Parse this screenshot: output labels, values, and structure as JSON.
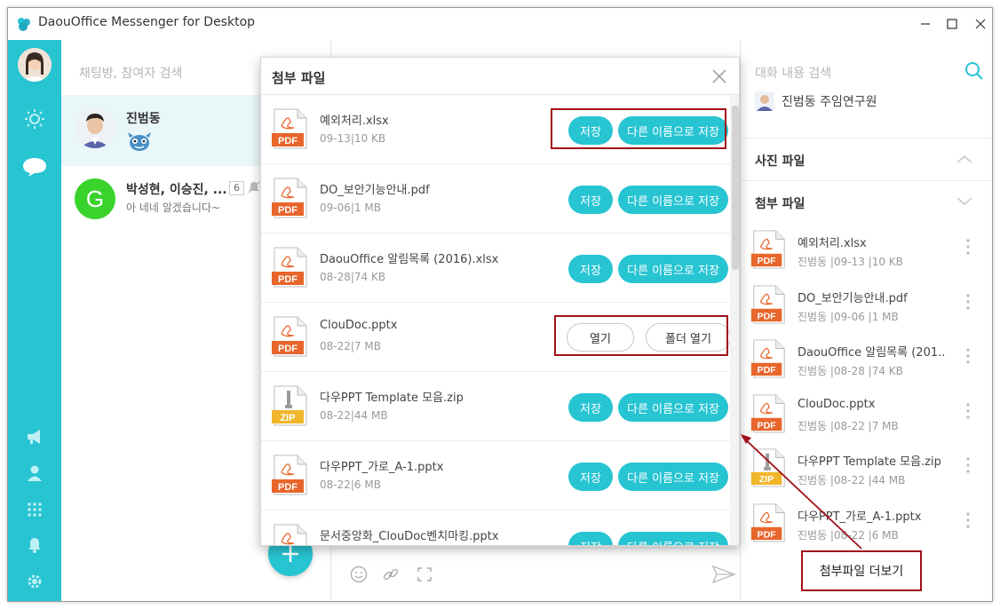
{
  "window": {
    "title": "DaouOffice Messenger for Desktop"
  },
  "chatlist": {
    "search_placeholder": "채팅방, 참여자 검색",
    "items": [
      {
        "name": "진범동",
        "preview": ""
      },
      {
        "name": "박성현, 이승진, ...",
        "preview": "아 네네 알겠습니다~",
        "count": "6",
        "avatar_letter": "G"
      }
    ]
  },
  "modal": {
    "title": "첨부 파일",
    "files": [
      {
        "name": "예외처리.xlsx",
        "meta": "09-13|10 KB",
        "type": "PDF",
        "btn1": "저장",
        "btn2": "다른 이름으로 저장"
      },
      {
        "name": "DO_보안기능안내.pdf",
        "meta": "09-06|1 MB",
        "type": "PDF",
        "btn1": "저장",
        "btn2": "다른 이름으로 저장"
      },
      {
        "name": "DaouOffice 알림목록 (2016).xlsx",
        "meta": "08-28|74 KB",
        "type": "PDF",
        "btn1": "저장",
        "btn2": "다른 이름으로 저장"
      },
      {
        "name": "ClouDoc.pptx",
        "meta": "08-22|7 MB",
        "type": "PDF",
        "btn1": "열기",
        "btn2": "폴더 열기"
      },
      {
        "name": "다우PPT Template 모음.zip",
        "meta": "08-22|44 MB",
        "type": "ZIP",
        "btn1": "저장",
        "btn2": "다른 이름으로 저장"
      },
      {
        "name": "다우PPT_가로_A-1.pptx",
        "meta": "08-22|6 MB",
        "type": "PDF",
        "btn1": "저장",
        "btn2": "다른 이름으로 저장"
      },
      {
        "name": "문서중앙화_ClouDoc벤치마킹.pptx",
        "meta": "",
        "type": "PDF",
        "btn1": "저장",
        "btn2": "다른 이름으로 저장"
      }
    ]
  },
  "rpanel": {
    "search_placeholder": "대화 내용 검색",
    "member": "진범동 주임연구원",
    "photo_section": "사진 파일",
    "attach_section": "첨부 파일",
    "files": [
      {
        "name": "예외처리.xlsx",
        "meta": "진범동 |09-13 |10 KB",
        "type": "PDF"
      },
      {
        "name": "DO_보안기능안내.pdf",
        "meta": "진범동 |09-06 |1 MB",
        "type": "PDF"
      },
      {
        "name": "DaouOffice 알림목록 (201..",
        "meta": "진범동 |08-28 |74 KB",
        "type": "PDF"
      },
      {
        "name": "ClouDoc.pptx",
        "meta": "진범동 |08-22 |7 MB",
        "type": "PDF"
      },
      {
        "name": "다우PPT Template 모음.zip",
        "meta": "진범동 |08-22 |44 MB",
        "type": "ZIP"
      },
      {
        "name": "다우PPT_가로_A-1.pptx",
        "meta": "진범동 |08-22 |6 MB",
        "type": "PDF"
      }
    ]
  },
  "annotation": {
    "callout": "첨부파일 더보기"
  },
  "colors": {
    "accent": "#27c4d2",
    "highlight": "#a1111a",
    "pdf": "#e8652b",
    "zip": "#f0b52a"
  }
}
